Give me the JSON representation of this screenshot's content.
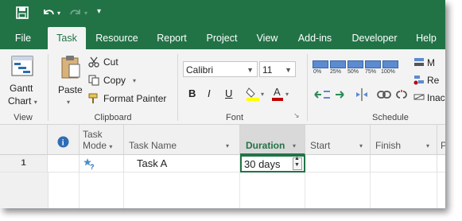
{
  "quick_access": {
    "save_icon": "save-icon",
    "undo_icon": "undo-icon",
    "redo_icon": "redo-icon",
    "customize_icon": "customize-qat-icon"
  },
  "tabs": [
    {
      "label": "File"
    },
    {
      "label": "Task"
    },
    {
      "label": "Resource"
    },
    {
      "label": "Report"
    },
    {
      "label": "Project"
    },
    {
      "label": "View"
    },
    {
      "label": "Add-ins"
    },
    {
      "label": "Developer"
    },
    {
      "label": "Help"
    }
  ],
  "ribbon": {
    "view_group": {
      "gantt_chart_label_1": "Gantt",
      "gantt_chart_label_2": "Chart",
      "group_label": "View"
    },
    "clipboard_group": {
      "paste_label": "Paste",
      "cut_label": "Cut",
      "copy_label": "Copy",
      "format_painter_label": "Format Painter",
      "group_label": "Clipboard"
    },
    "font_group": {
      "font_name": "Calibri",
      "font_size": "11",
      "bold": "B",
      "italic": "I",
      "underline": "U",
      "group_label": "Font"
    },
    "schedule_group": {
      "pct_labels": [
        "0%",
        "25%",
        "50%",
        "75%",
        "100%"
      ],
      "mark_label": "M",
      "respect_label": "Re",
      "inactivate_label": "Inac",
      "group_label": "Schedule"
    }
  },
  "grid": {
    "headers": {
      "info": "i",
      "task_mode_1": "Task",
      "task_mode_2": "Mode",
      "task_name": "Task Name",
      "duration": "Duration",
      "start": "Start",
      "finish": "Finish",
      "pred": "P"
    },
    "rows": [
      {
        "id": "1",
        "task_name": "Task A",
        "duration": "30 days"
      }
    ]
  },
  "colors": {
    "accent": "#217346",
    "selected_header": "#dcdcdc",
    "font_color_red": "#c00000",
    "highlight_yellow": "#ffff00"
  }
}
